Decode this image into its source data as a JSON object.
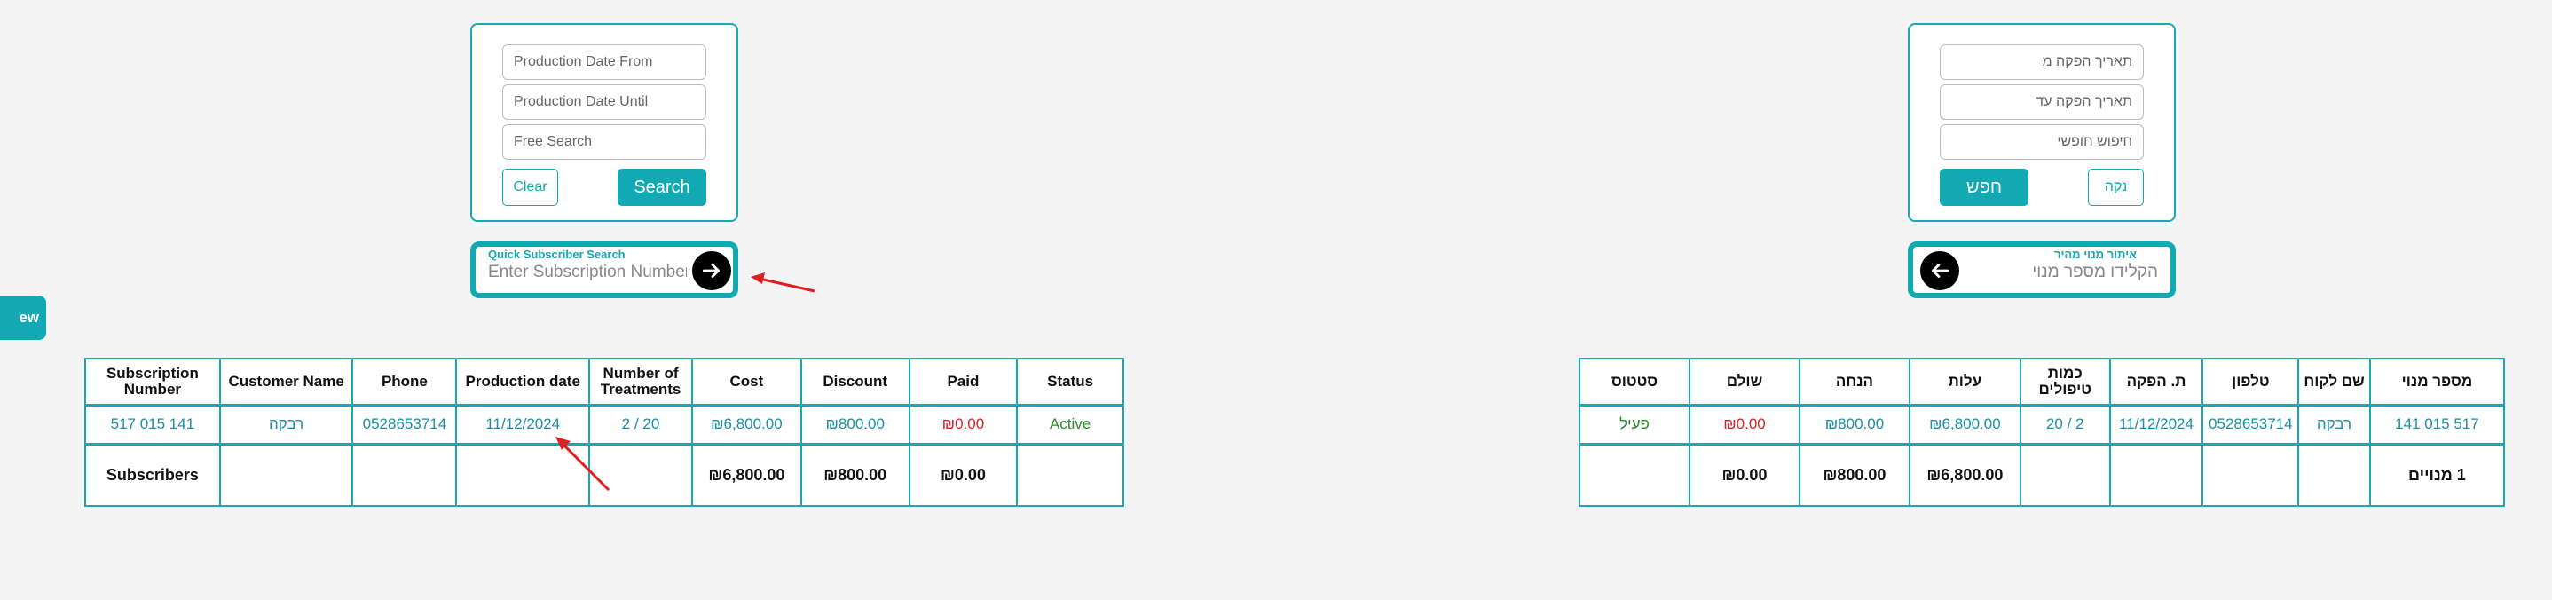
{
  "side_tab": {
    "label": "ew"
  },
  "en": {
    "search": {
      "date_from_placeholder": "Production Date From",
      "date_until_placeholder": "Production Date Until",
      "free_search_placeholder": "Free Search",
      "clear_label": "Clear",
      "search_label": "Search"
    },
    "quick": {
      "title": "Quick Subscriber Search",
      "placeholder": "Enter Subscription Number"
    },
    "table": {
      "headers": [
        "Subscription Number",
        "Customer Name",
        "Phone",
        "Production date",
        "Number of Treatments",
        "Cost",
        "Discount",
        "Paid",
        "Status"
      ],
      "row": [
        "517 015 141",
        "רבקה",
        "0528653714",
        "11/12/2024",
        "2 / 20",
        "₪6,800.00",
        "₪800.00",
        "₪0.00",
        "Active"
      ],
      "totals": [
        "Subscribers",
        "",
        "",
        "",
        "",
        "₪6,800.00",
        "₪800.00",
        "₪0.00",
        ""
      ]
    }
  },
  "he": {
    "search": {
      "date_from_placeholder": "תאריך הפקה מ",
      "date_until_placeholder": "תאריך הפקה עד",
      "free_search_placeholder": "חיפוש חופשי",
      "clear_label": "נקה",
      "search_label": "חפש"
    },
    "quick": {
      "title": "איתור מנוי מהיר",
      "placeholder": "הקלידו מספר מנוי"
    },
    "table": {
      "headers": [
        "מספר מנוי",
        "שם לקוח",
        "טלפון",
        "ת. הפקה",
        "כמות טיפולים",
        "עלות",
        "הנחה",
        "שולם",
        "סטטוס"
      ],
      "row": [
        "517 015 141",
        "רבקה",
        "0528653714",
        "11/12/2024",
        "2 / 20",
        "₪6,800.00",
        "₪800.00",
        "₪0.00",
        "פעיל"
      ],
      "totals": [
        "1 מנויים",
        "",
        "",
        "",
        "",
        "₪6,800.00",
        "₪800.00",
        "₪0.00",
        ""
      ]
    }
  },
  "colors": {
    "accent": "#13a9b3",
    "paid_red": "#e02020",
    "status_green": "#2a8a2a",
    "annotation_arrow": "#e02020"
  }
}
